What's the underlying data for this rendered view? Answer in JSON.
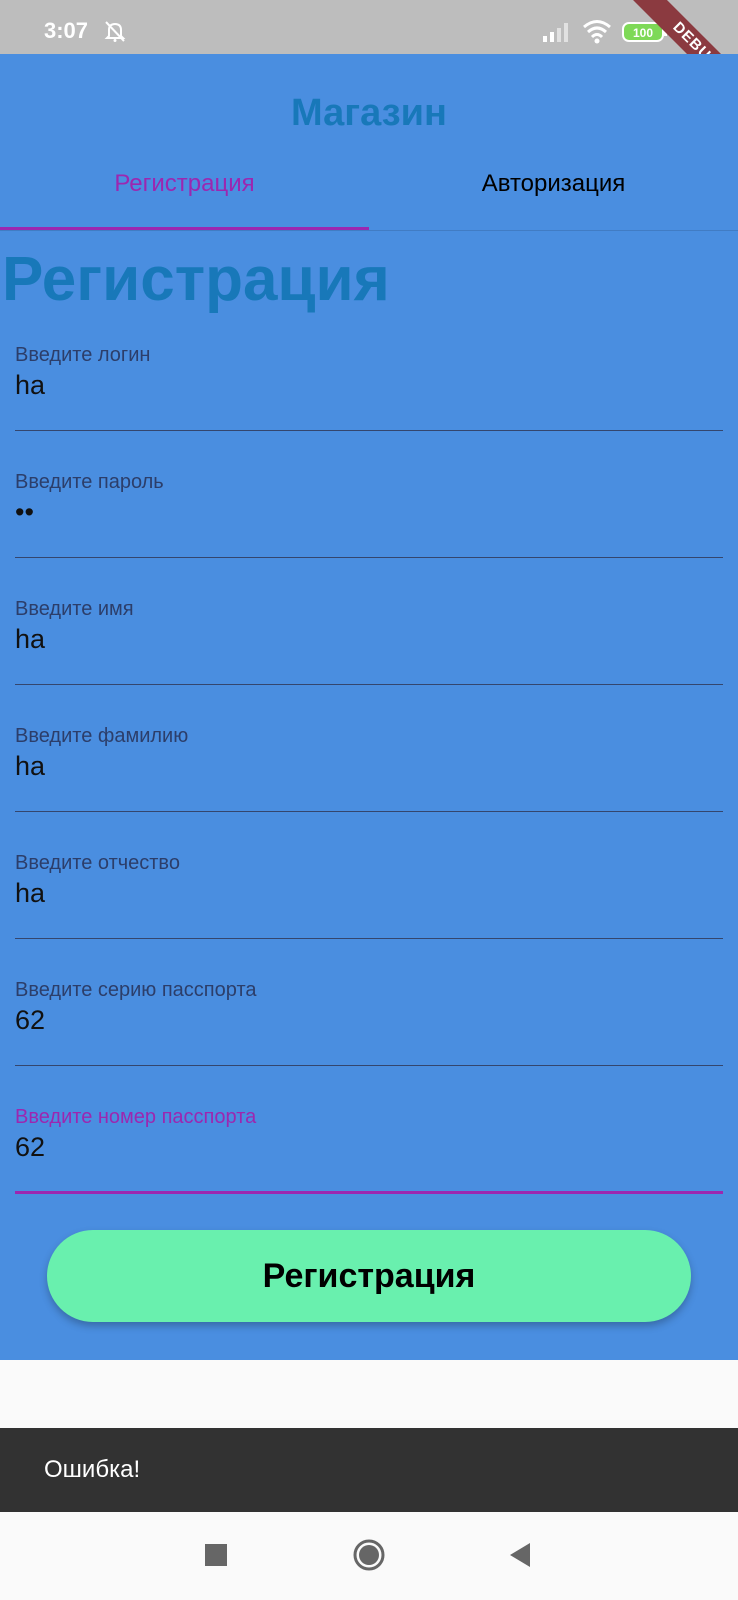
{
  "status_bar": {
    "time": "3:07",
    "battery": "100",
    "icons": [
      "bell-off-icon",
      "signal-icon",
      "wifi-icon",
      "battery-icon"
    ]
  },
  "debug_banner": "DEBUG",
  "app_bar": {
    "title": "Магазин"
  },
  "tabs": [
    {
      "label": "Регистрация",
      "active": true
    },
    {
      "label": "Авторизация",
      "active": false
    }
  ],
  "page_title": "Регистрация",
  "fields": [
    {
      "label": "Введите логин",
      "value": "ha"
    },
    {
      "label": "Введите пароль",
      "value": "••"
    },
    {
      "label": "Введите имя",
      "value": "ha"
    },
    {
      "label": "Введите фамилию",
      "value": "ha"
    },
    {
      "label": "Введите отчество",
      "value": "ha"
    },
    {
      "label": "Введите серию пасспорта",
      "value": "62"
    },
    {
      "label": "Введите номер пасспорта",
      "value": "62"
    }
  ],
  "submit_button": "Регистрация",
  "snackbar": "Ошибка!",
  "colors": {
    "primary_blue": "#4a8ee0",
    "title_blue": "#1878b9",
    "accent_purple": "#9c27b0",
    "button_green": "#69f0ae"
  }
}
